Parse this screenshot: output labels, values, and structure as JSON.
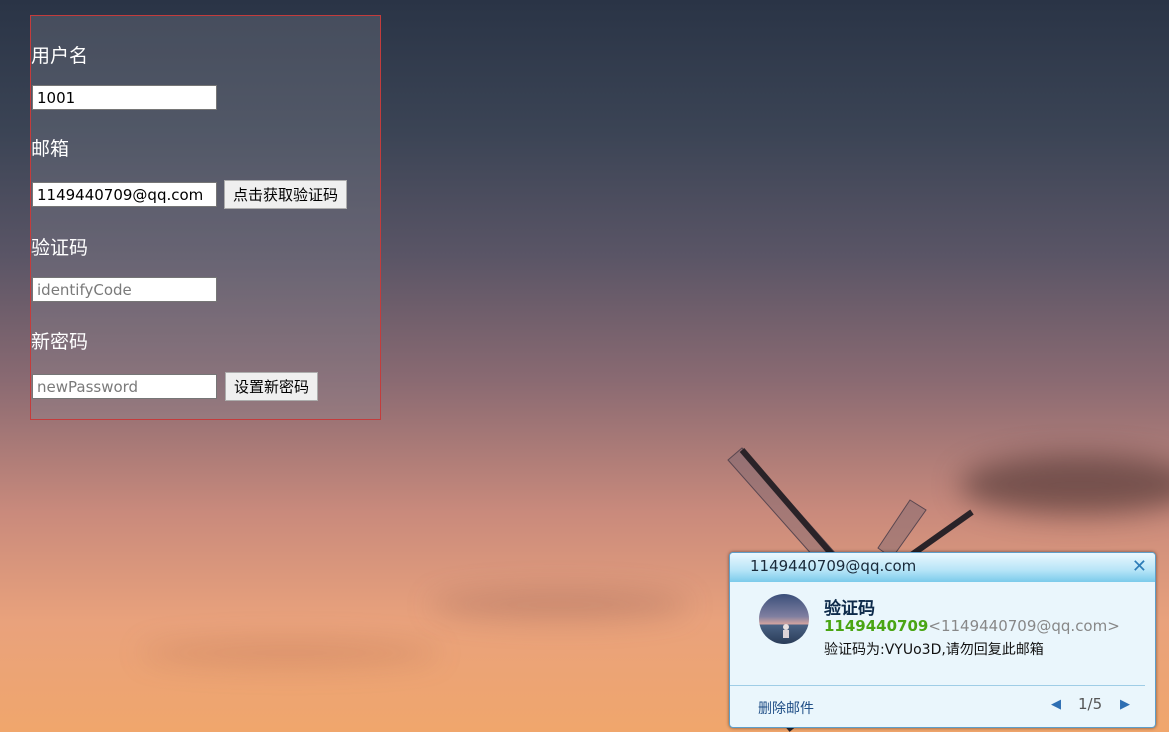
{
  "form": {
    "username_label": "用户名",
    "username_value": "1001",
    "email_label": "邮箱",
    "email_value": "1149440709@qq.com",
    "get_code_button": "点击获取验证码",
    "code_label": "验证码",
    "code_placeholder": "identifyCode",
    "new_password_label": "新密码",
    "new_password_placeholder": "newPassword",
    "set_password_button": "设置新密码"
  },
  "notification": {
    "account": "1149440709@qq.com",
    "close_icon": "close-icon",
    "subject": "验证码",
    "sender_name": "1149440709",
    "sender_email": "<1149440709@qq.com>",
    "body": "验证码为:VYUo3D,请勿回复此邮箱",
    "delete_label": "删除邮件",
    "page_indicator": "1/5",
    "prev_icon": "triangle-left-icon",
    "next_icon": "triangle-right-icon"
  },
  "colors": {
    "panel_border": "#c33c3c",
    "sender_green": "#4aa513",
    "accent_blue": "#2e7db8"
  }
}
